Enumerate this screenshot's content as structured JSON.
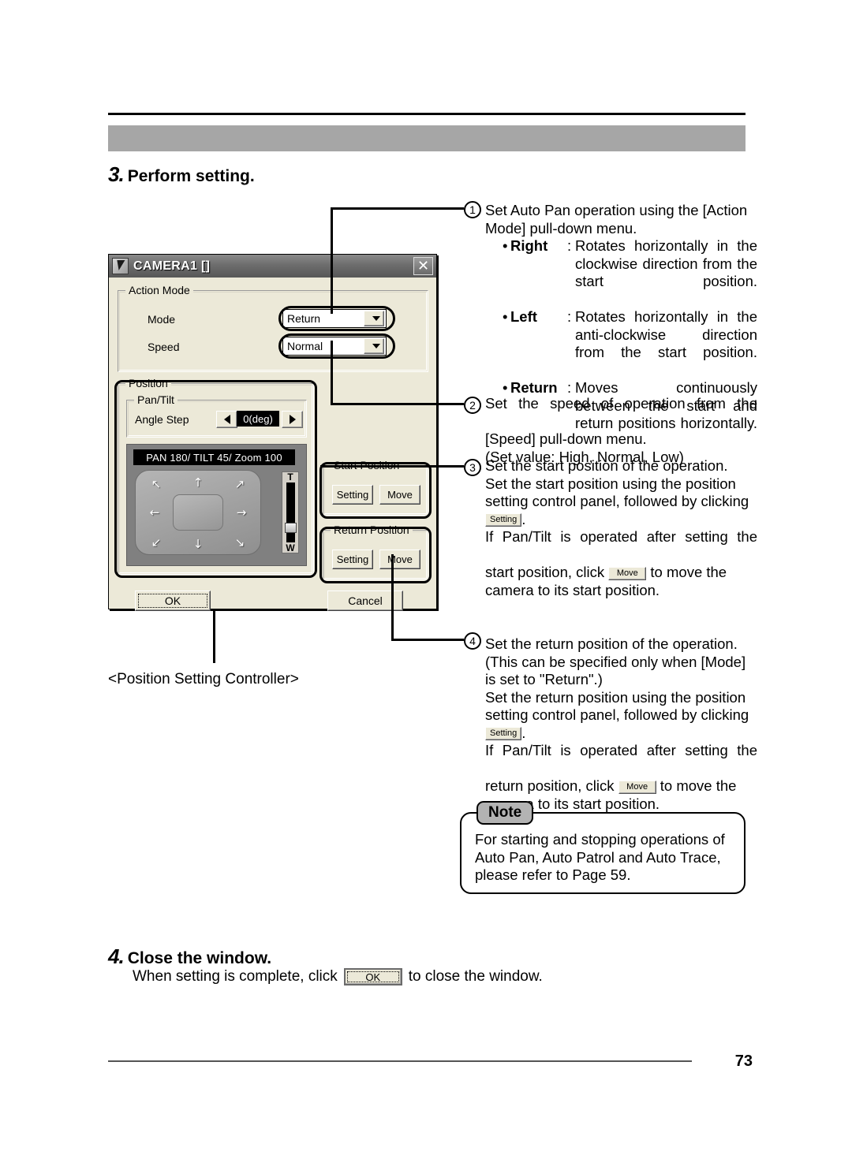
{
  "page": {
    "number": "73"
  },
  "step3": {
    "num": "3.",
    "title": "Perform setting."
  },
  "step4": {
    "num": "4.",
    "title": "Close the window.",
    "pre": "When setting is complete, click",
    "button": "OK",
    "post": "to close the window."
  },
  "caption": "<Position Setting Controller>",
  "dialog": {
    "title": "CAMERA1  []",
    "close_label": "✕",
    "action_mode": {
      "legend": "Action Mode",
      "mode_label": "Mode",
      "mode_value": "Return",
      "speed_label": "Speed",
      "speed_value": "Normal"
    },
    "position": {
      "legend": "Position",
      "pantilt_legend": "Pan/Tilt",
      "angle_label": "Angle Step",
      "angle_value": "0(deg)",
      "lcd": "PAN 180/ TILT 45/ Zoom 100",
      "zoom_tele": "T",
      "zoom_wide": "W",
      "arrows": {
        "up_left": "↖",
        "up": "↑",
        "up_right": "↗",
        "left": "←",
        "right": "→",
        "down_left": "↙",
        "down": "↓",
        "down_right": "↘"
      }
    },
    "start_position": {
      "legend": "Start Position",
      "setting": "Setting",
      "move": "Move"
    },
    "return_position": {
      "legend": "Return Position",
      "setting": "Setting",
      "move": "Move"
    },
    "ok": "OK",
    "cancel": "Cancel"
  },
  "callouts": {
    "one": "1",
    "two": "2",
    "three": "3",
    "four": "4"
  },
  "items": {
    "one": {
      "line1": "Set Auto Pan operation using the [Action",
      "line2": "Mode] pull-down menu.",
      "defs": [
        {
          "bullet": "•",
          "term": "Right",
          "colon": ":",
          "desc": "Rotates horizontally in the clockwise direction from the start position."
        },
        {
          "bullet": "•",
          "term": "Left",
          "colon": ":",
          "desc": "Rotates horizontally in the anti-clockwise direction from the start position."
        },
        {
          "bullet": "•",
          "term": "Return",
          "colon": ":",
          "desc": "Moves continuously between the start and return positions horizontally."
        }
      ]
    },
    "two": {
      "line1": "Set the speed of operation from the",
      "line2": "[Speed] pull-down menu.",
      "line3": "(Set value: High, Normal, Low)"
    },
    "three": {
      "line1": "Set the start position of the operation.",
      "line2": "Set the start position using the position",
      "line3": "setting control panel, followed by clicking",
      "btn_setting": "Setting",
      "period": ".",
      "line4": "If Pan/Tilt is operated after setting the",
      "line5a": "start position, click",
      "btn_move": "Move",
      "line5b": "to move the",
      "line6": "camera to its start position."
    },
    "four": {
      "line1": "Set the return position of the operation.",
      "line2": "(This can be specified only when [Mode]",
      "line3": "is set to \"Return\".)",
      "line4": "Set the return position using the position",
      "line5": "setting control panel, followed by clicking",
      "btn_setting": "Setting",
      "period": ".",
      "line6": "If Pan/Tilt is operated after setting the",
      "line7a": "return position, click",
      "btn_move": "Move",
      "line7b": "to move the",
      "line8": "camera to its start position."
    }
  },
  "note": {
    "tab": "Note",
    "line1": "For starting and stopping operations of",
    "line2": "Auto Pan, Auto Patrol and Auto Trace,",
    "line3": "please refer to Page 59."
  }
}
